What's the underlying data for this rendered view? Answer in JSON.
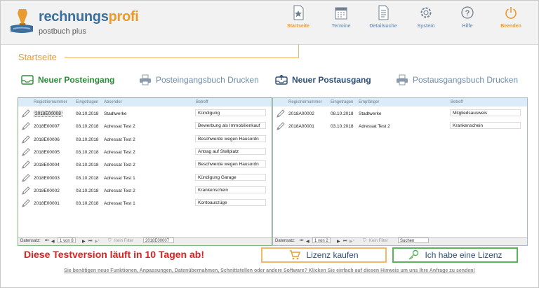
{
  "app": {
    "brand_part1": "rechnungs",
    "brand_part2": "profi",
    "subtitle": "postbuch plus"
  },
  "nav": [
    {
      "label": "Startseite",
      "icon": "star-document-icon",
      "active": true
    },
    {
      "label": "Termine",
      "icon": "calendar-icon",
      "active": false
    },
    {
      "label": "Detailsuche",
      "icon": "document-search-icon",
      "active": false
    },
    {
      "label": "System",
      "icon": "gear-icon",
      "active": false
    },
    {
      "label": "Hilfe",
      "icon": "help-icon",
      "active": false
    },
    {
      "label": "Beenden",
      "icon": "power-icon",
      "active": false
    }
  ],
  "page_title": "Startseite",
  "actions": {
    "new_incoming": "Neuer Posteingang",
    "print_incoming": "Posteingangsbuch Drucken",
    "new_outgoing": "Neuer Postausgang",
    "print_outgoing": "Postausgangsbuch Drucken"
  },
  "incoming": {
    "columns": [
      "Registriernummer",
      "Eingetragen",
      "Absender",
      "Betreff"
    ],
    "rows": [
      {
        "nr": "2018E00008",
        "date": "08.10.2018",
        "party": "Stadtwerke",
        "subject": "Kündigung"
      },
      {
        "nr": "2018E00007",
        "date": "03.10.2018",
        "party": "Adressat Test 2",
        "subject": "Bewerbung als Immobilienkauf"
      },
      {
        "nr": "2018E00006",
        "date": "03.10.2018",
        "party": "Adressat Test 2",
        "subject": "Beschwerde wegen Hausordn"
      },
      {
        "nr": "2018E00005",
        "date": "03.10.2018",
        "party": "Adressat Test 2",
        "subject": "Antrag auf Stellplatz"
      },
      {
        "nr": "2018E00004",
        "date": "03.10.2018",
        "party": "Adressat Test 2",
        "subject": "Beschwerde wegen Hausordn"
      },
      {
        "nr": "2018E00003",
        "date": "03.10.2018",
        "party": "Adressat Test 1",
        "subject": "Kündigung Garage"
      },
      {
        "nr": "2018E00002",
        "date": "03.10.2018",
        "party": "Adressat Test 2",
        "subject": "Krankenschein"
      },
      {
        "nr": "2018E00001",
        "date": "03.10.2018",
        "party": "Adressat Test 1",
        "subject": "Kontoauszüge"
      }
    ],
    "pager": {
      "label": "Datensatz:",
      "position": "1 von 8",
      "filter": "Kein Filter",
      "search": "2018E00007"
    }
  },
  "outgoing": {
    "columns": [
      "Registriernummer",
      "Eingetragen",
      "Empfänger",
      "Betreff"
    ],
    "rows": [
      {
        "nr": "2018A00002",
        "date": "08.10.2018",
        "party": "Stadtwerke",
        "subject": "Mitgliedsausweis"
      },
      {
        "nr": "2018A00001",
        "date": "03.10.2018",
        "party": "Adressat Test 2",
        "subject": "Krankenschein"
      }
    ],
    "pager": {
      "label": "Datensatz:",
      "position": "1 von 2",
      "filter": "Kein Filter",
      "search": "Suchen"
    }
  },
  "trial_notice": "Diese Testversion läuft in 10 Tagen ab!",
  "buttons": {
    "buy": "Lizenz kaufen",
    "have_license": "Ich habe eine Lizenz"
  },
  "footer_link": "Sie benötigen neue Funktionen, Anpassungen, Datenübernahmen, Schnittstellen oder andere Software? Klicken Sie einfach auf diesen Hinweis um uns Ihre Anfrage zu senden!",
  "colors": {
    "accent_orange": "#e99b2d",
    "brand_blue": "#3d6f9c",
    "green": "#2e8b3a",
    "alert_red": "#e02020"
  }
}
